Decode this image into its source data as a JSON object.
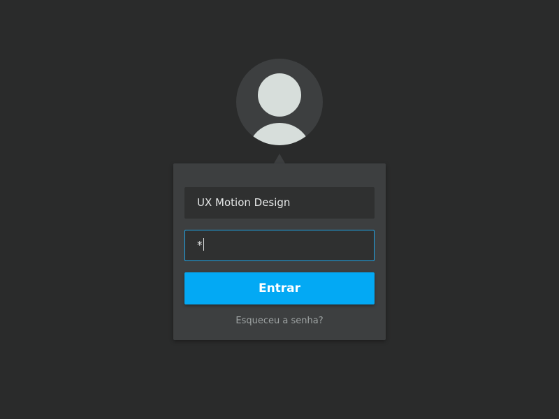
{
  "login": {
    "username_value": "UX Motion Design",
    "password_value": "*",
    "submit_label": "Entrar",
    "forgot_link": "Esqueceu a senha?"
  },
  "icons": {
    "avatar": "user-avatar-icon"
  },
  "colors": {
    "background": "#2a2b2b",
    "card": "#3d3f40",
    "field": "#2f3030",
    "accent": "#03a9f4",
    "focus_border": "#1fa6e8",
    "avatar_figure": "#d7dedb",
    "link_text": "#9ea3a3"
  }
}
